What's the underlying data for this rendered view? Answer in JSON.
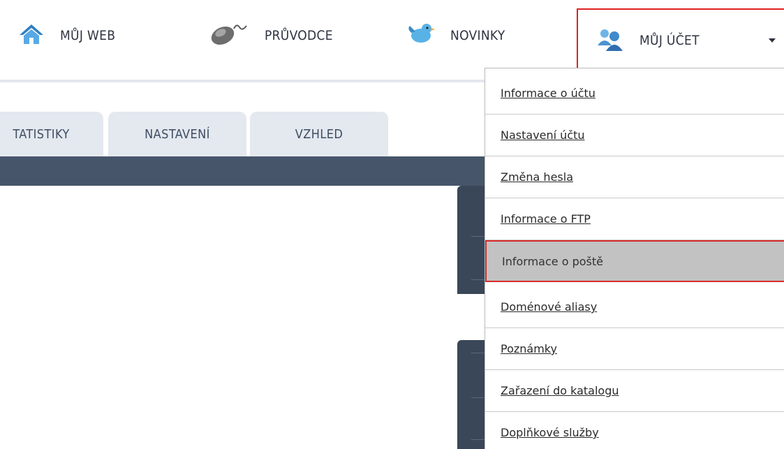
{
  "nav": {
    "items": [
      {
        "label": "MŮJ WEB",
        "icon": "home-icon"
      },
      {
        "label": "PRŮVODCE",
        "icon": "mouse-icon"
      },
      {
        "label": "NOVINKY",
        "icon": "bird-icon"
      },
      {
        "label": "MŮJ ÚČET",
        "icon": "users-icon"
      }
    ]
  },
  "tabs": [
    {
      "label": "TATISTIKY"
    },
    {
      "label": "NASTAVENÍ"
    },
    {
      "label": "VZHLED"
    }
  ],
  "account_menu": {
    "items": [
      {
        "label": "Informace o účtu"
      },
      {
        "label": "Nastavení účtu"
      },
      {
        "label": "Změna hesla"
      },
      {
        "label": "Informace o FTP"
      },
      {
        "label": "Informace o poště",
        "active": true
      },
      {
        "label": "Doménové aliasy"
      },
      {
        "label": "Poznámky"
      },
      {
        "label": "Zařazení do katalogu"
      },
      {
        "label": "Doplňkové služby"
      }
    ]
  },
  "colors": {
    "accent_red": "#e02020",
    "dark_band": "#465569",
    "tab_bg": "#e4e8ef",
    "nav_text": "#2e3340",
    "active_item_bg": "#c2c2c2"
  }
}
